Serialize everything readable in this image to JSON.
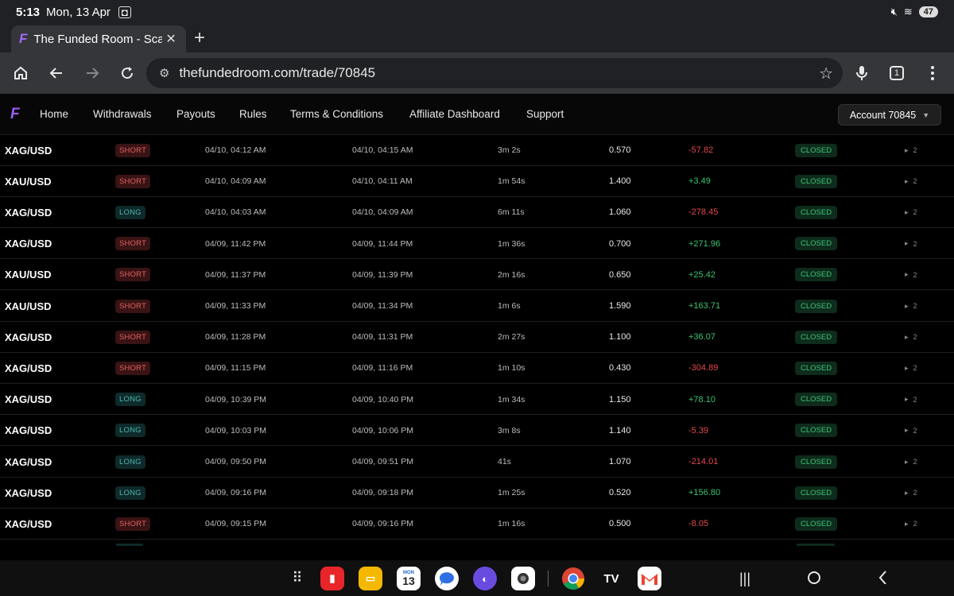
{
  "status_bar": {
    "time": "5:13",
    "date": "Mon, 13 Apr",
    "battery": "47"
  },
  "browser": {
    "tab_title": "The Funded Room - Scal",
    "url": "thefundedroom.com/trade/70845",
    "tab_count": "1"
  },
  "site_nav": {
    "links": [
      "Home",
      "Withdrawals",
      "Payouts",
      "Rules",
      "Terms & Conditions",
      "Affiliate Dashboard",
      "Support"
    ],
    "account_label": "Account 70845"
  },
  "trades": [
    {
      "symbol": "XAG/USD",
      "side": "SHORT",
      "open": "04/10, 04:12 AM",
      "close": "04/10, 04:15 AM",
      "duration": "3m 2s",
      "lots": "0.570",
      "pnl": "-57.82",
      "status": "CLOSED",
      "count": "2"
    },
    {
      "symbol": "XAU/USD",
      "side": "SHORT",
      "open": "04/10, 04:09 AM",
      "close": "04/10, 04:11 AM",
      "duration": "1m 54s",
      "lots": "1.400",
      "pnl": "+3.49",
      "status": "CLOSED",
      "count": "2"
    },
    {
      "symbol": "XAG/USD",
      "side": "LONG",
      "open": "04/10, 04:03 AM",
      "close": "04/10, 04:09 AM",
      "duration": "6m 11s",
      "lots": "1.060",
      "pnl": "-278.45",
      "status": "CLOSED",
      "count": "2"
    },
    {
      "symbol": "XAG/USD",
      "side": "SHORT",
      "open": "04/09, 11:42 PM",
      "close": "04/09, 11:44 PM",
      "duration": "1m 36s",
      "lots": "0.700",
      "pnl": "+271.96",
      "status": "CLOSED",
      "count": "2"
    },
    {
      "symbol": "XAU/USD",
      "side": "SHORT",
      "open": "04/09, 11:37 PM",
      "close": "04/09, 11:39 PM",
      "duration": "2m 16s",
      "lots": "0.650",
      "pnl": "+25.42",
      "status": "CLOSED",
      "count": "2"
    },
    {
      "symbol": "XAU/USD",
      "side": "SHORT",
      "open": "04/09, 11:33 PM",
      "close": "04/09, 11:34 PM",
      "duration": "1m 6s",
      "lots": "1.590",
      "pnl": "+163.71",
      "status": "CLOSED",
      "count": "2"
    },
    {
      "symbol": "XAG/USD",
      "side": "SHORT",
      "open": "04/09, 11:28 PM",
      "close": "04/09, 11:31 PM",
      "duration": "2m 27s",
      "lots": "1.100",
      "pnl": "+36.07",
      "status": "CLOSED",
      "count": "2"
    },
    {
      "symbol": "XAG/USD",
      "side": "SHORT",
      "open": "04/09, 11:15 PM",
      "close": "04/09, 11:16 PM",
      "duration": "1m 10s",
      "lots": "0.430",
      "pnl": "-304.89",
      "status": "CLOSED",
      "count": "2"
    },
    {
      "symbol": "XAG/USD",
      "side": "LONG",
      "open": "04/09, 10:39 PM",
      "close": "04/09, 10:40 PM",
      "duration": "1m 34s",
      "lots": "1.150",
      "pnl": "+78.10",
      "status": "CLOSED",
      "count": "2"
    },
    {
      "symbol": "XAG/USD",
      "side": "LONG",
      "open": "04/09, 10:03 PM",
      "close": "04/09, 10:06 PM",
      "duration": "3m 8s",
      "lots": "1.140",
      "pnl": "-5.39",
      "status": "CLOSED",
      "count": "2"
    },
    {
      "symbol": "XAG/USD",
      "side": "LONG",
      "open": "04/09, 09:50 PM",
      "close": "04/09, 09:51 PM",
      "duration": "41s",
      "lots": "1.070",
      "pnl": "-214.01",
      "status": "CLOSED",
      "count": "2"
    },
    {
      "symbol": "XAG/USD",
      "side": "LONG",
      "open": "04/09, 09:16 PM",
      "close": "04/09, 09:18 PM",
      "duration": "1m 25s",
      "lots": "0.520",
      "pnl": "+156.80",
      "status": "CLOSED",
      "count": "2"
    },
    {
      "symbol": "XAG/USD",
      "side": "SHORT",
      "open": "04/09, 09:15 PM",
      "close": "04/09, 09:16 PM",
      "duration": "1m 16s",
      "lots": "0.500",
      "pnl": "-8.05",
      "status": "CLOSED",
      "count": "2"
    }
  ],
  "taskbar": {
    "calendar_day": "13",
    "calendar_month": "MON",
    "apps": [
      "app-drawer",
      "flip-notes",
      "my-files",
      "calendar",
      "messages",
      "browser",
      "camera",
      "chrome",
      "tradingview",
      "gmail"
    ]
  }
}
